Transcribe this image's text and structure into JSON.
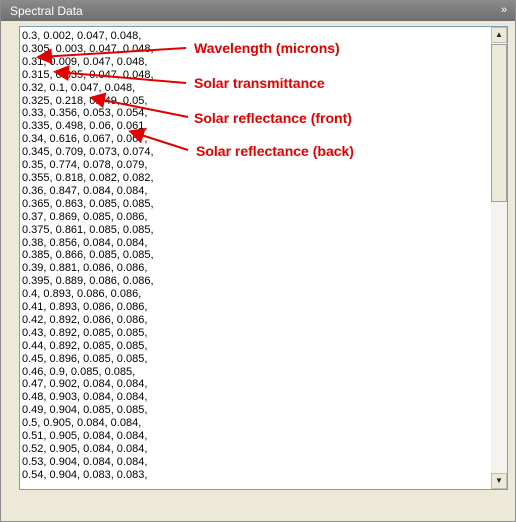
{
  "panel": {
    "title": "Spectral Data",
    "collapse_icon": "double-chevron-down-icon"
  },
  "spectral_lines": [
    "0.3, 0.002, 0.047, 0.048,",
    "0.305, 0.003, 0.047, 0.048,",
    "0.31, 0.009, 0.047, 0.048,",
    "0.315, 0.035, 0.047, 0.048,",
    "0.32, 0.1, 0.047, 0.048,",
    "0.325, 0.218, 0.049, 0.05,",
    "0.33, 0.356, 0.053, 0.054,",
    "0.335, 0.498, 0.06, 0.061,",
    "0.34, 0.616, 0.067, 0.067,",
    "0.345, 0.709, 0.073, 0.074,",
    "0.35, 0.774, 0.078, 0.079,",
    "0.355, 0.818, 0.082, 0.082,",
    "0.36, 0.847, 0.084, 0.084,",
    "0.365, 0.863, 0.085, 0.085,",
    "0.37, 0.869, 0.085, 0.086,",
    "0.375, 0.861, 0.085, 0.085,",
    "0.38, 0.856, 0.084, 0.084,",
    "0.385, 0.866, 0.085, 0.085,",
    "0.39, 0.881, 0.086, 0.086,",
    "0.395, 0.889, 0.086, 0.086,",
    "0.4, 0.893, 0.086, 0.086,",
    "0.41, 0.893, 0.086, 0.086,",
    "0.42, 0.892, 0.086, 0.086,",
    "0.43, 0.892, 0.085, 0.085,",
    "0.44, 0.892, 0.085, 0.085,",
    "0.45, 0.896, 0.085, 0.085,",
    "0.46, 0.9, 0.085, 0.085,",
    "0.47, 0.902, 0.084, 0.084,",
    "0.48, 0.903, 0.084, 0.084,",
    "0.49, 0.904, 0.085, 0.085,",
    "0.5, 0.905, 0.084, 0.084,",
    "0.51, 0.905, 0.084, 0.084,",
    "0.52, 0.905, 0.084, 0.084,",
    "0.53, 0.904, 0.084, 0.084,",
    "0.54, 0.904, 0.083, 0.083,"
  ],
  "annotations": {
    "wavelength": "Wavelength (microns)",
    "transmittance": "Solar transmittance",
    "reflectance_front": "Solar reflectance (front)",
    "reflectance_back": "Solar reflectance (back)"
  },
  "scrollbar": {
    "up_icon": "arrow-up-icon",
    "down_icon": "arrow-down-icon"
  },
  "colors": {
    "annotation": "#e00000",
    "titlebar": "#7a7a7a"
  }
}
